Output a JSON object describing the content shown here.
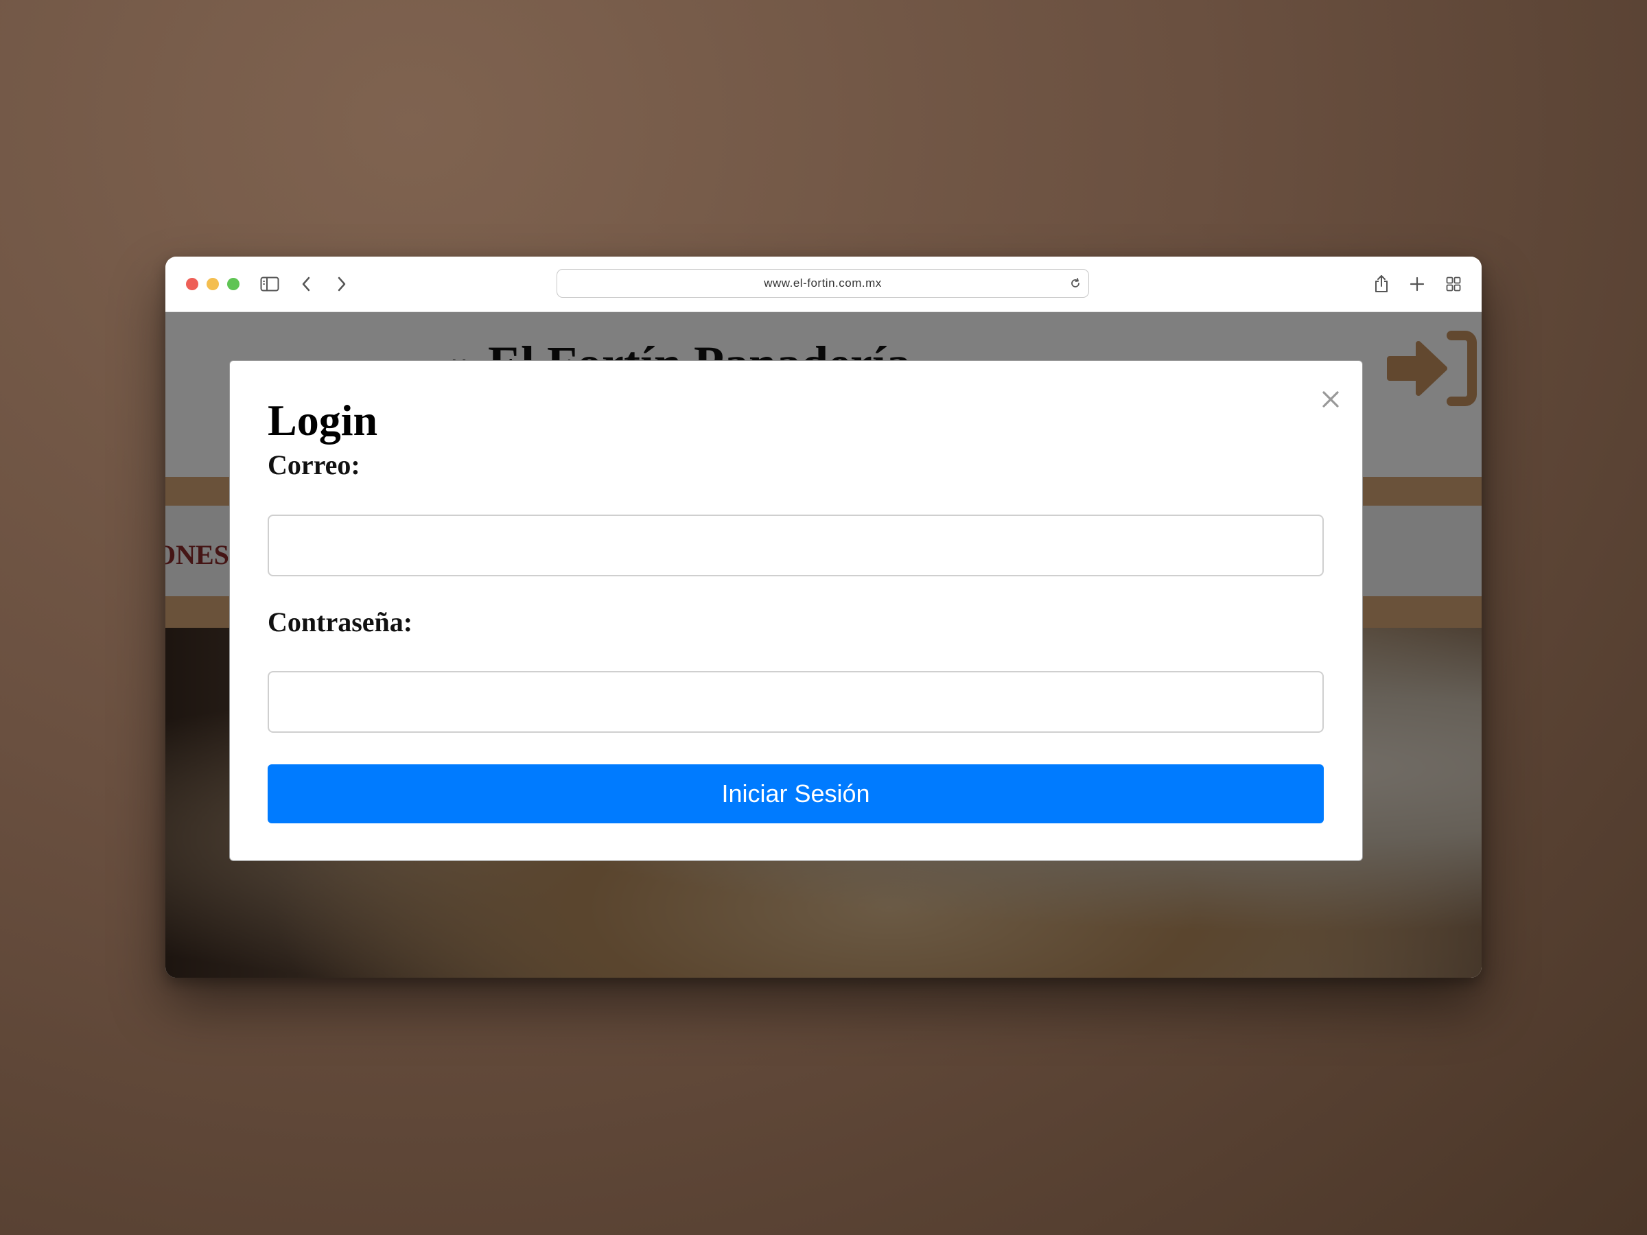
{
  "browser": {
    "url": "www.el-fortin.com.mx"
  },
  "site": {
    "title": "» El Fortín Panadería",
    "nav_item": "ONES"
  },
  "modal": {
    "title": "Login",
    "email_label": "Correo:",
    "email_value": "",
    "password_label": "Contraseña:",
    "password_value": "",
    "submit_label": "Iniciar Sesión"
  },
  "colors": {
    "accent": "#007bff",
    "nav_band": "#d4a574",
    "login_icon": "#c4915f"
  }
}
